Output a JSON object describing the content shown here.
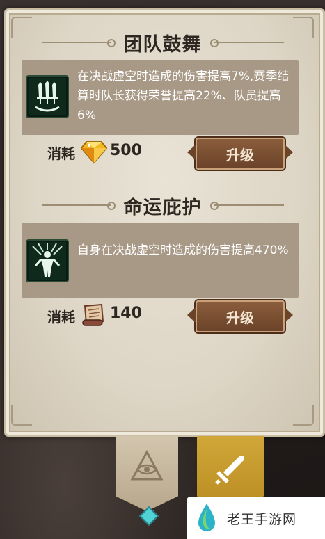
{
  "skills": [
    {
      "title": "团队鼓舞",
      "icon": "triple-sword-icon",
      "description": "在决战虚空时造成的伤害提高7%,赛季结算时队长获得荣誉提高22%、队员提高6%",
      "cost_label": "消耗",
      "cost_item_icon": "gem-icon",
      "cost_value": "500",
      "upgrade_label": "升级"
    },
    {
      "title": "命运庇护",
      "icon": "glowing-figure-icon",
      "description": "自身在决战虚空时造成的伤害提高470%",
      "cost_label": "消耗",
      "cost_item_icon": "scroll-icon",
      "cost_value": "140",
      "upgrade_label": "升级"
    }
  ],
  "tabs": [
    {
      "icon": "eye-pyramid-icon"
    },
    {
      "icon": "sword-icon"
    }
  ],
  "watermark": {
    "text": "老王手游网"
  },
  "colors": {
    "panel": "#ddd5c5",
    "desc_box": "#a89886",
    "button": "#7a4f32",
    "active_tab": "#c99a2c",
    "icon_bg": "#0f2a1c"
  }
}
